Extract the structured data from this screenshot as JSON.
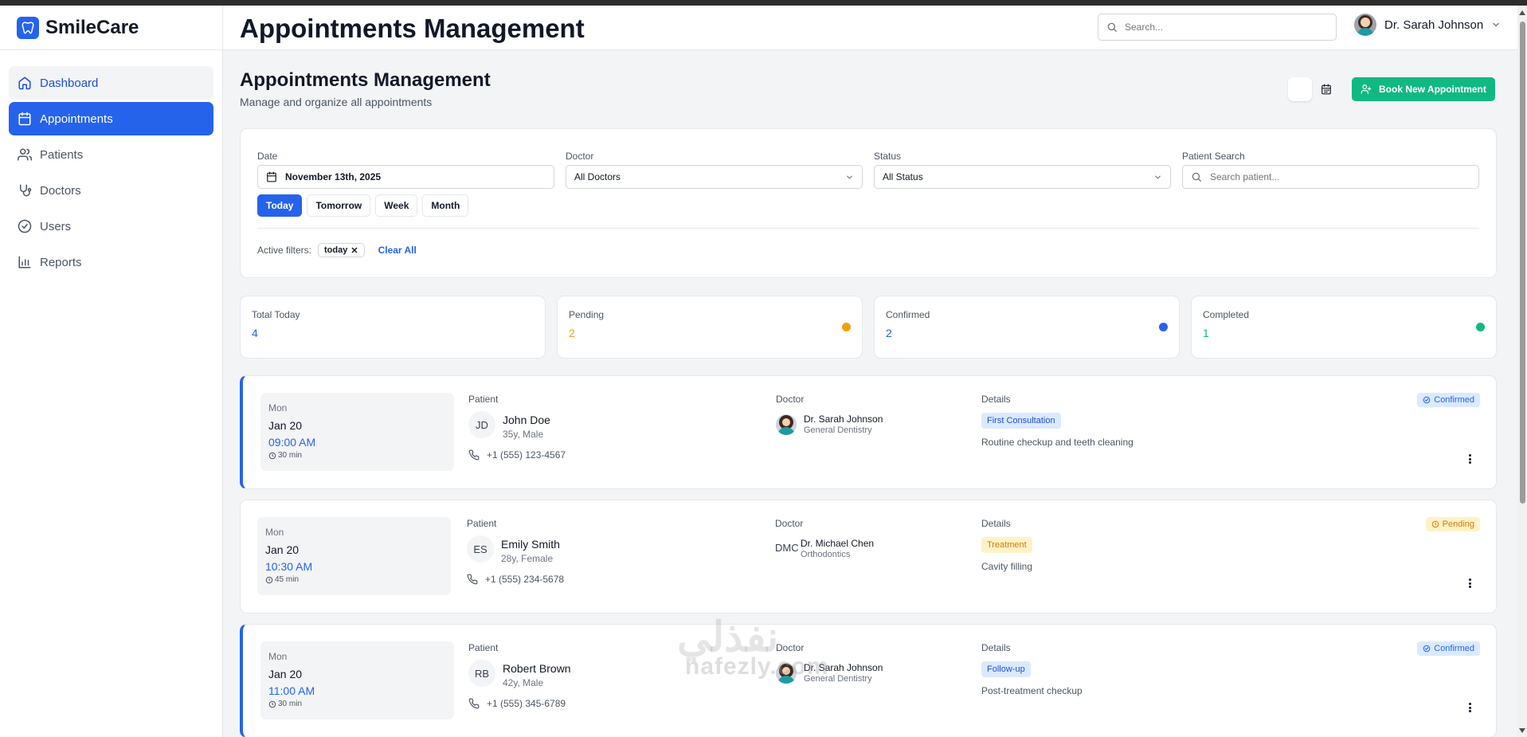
{
  "app": {
    "name": "SmileCare"
  },
  "sidebar": {
    "items": [
      {
        "label": "Dashboard"
      },
      {
        "label": "Appointments"
      },
      {
        "label": "Patients"
      },
      {
        "label": "Doctors"
      },
      {
        "label": "Users"
      },
      {
        "label": "Reports"
      }
    ],
    "active_index": 1,
    "hover_index": 0
  },
  "header": {
    "title": "Appointments Management",
    "search_placeholder": "Search...",
    "user_name": "Dr. Sarah Johnson"
  },
  "page": {
    "title": "Appointments Management",
    "subtitle": "Manage and organize all appointments",
    "book_button": "Book New Appointment"
  },
  "filters": {
    "date_label": "Date",
    "date_value": "November 13th, 2025",
    "doctor_label": "Doctor",
    "doctor_value": "All Doctors",
    "status_label": "Status",
    "status_value": "All Status",
    "search_label": "Patient Search",
    "search_placeholder": "Search patient...",
    "quick": [
      "Today",
      "Tomorrow",
      "Week",
      "Month"
    ],
    "quick_selected": "Today",
    "active_label": "Active filters:",
    "active_chip": "today",
    "clear_label": "Clear All"
  },
  "stats": [
    {
      "label": "Total Today",
      "value": "4",
      "color": "#2563eb"
    },
    {
      "label": "Pending",
      "value": "2",
      "color": "#f59e0b"
    },
    {
      "label": "Confirmed",
      "value": "2",
      "color": "#2563eb"
    },
    {
      "label": "Completed",
      "value": "1",
      "color": "#10b981"
    }
  ],
  "columns": {
    "patient": "Patient",
    "doctor": "Doctor",
    "details": "Details"
  },
  "appointments": [
    {
      "day": "Mon",
      "date": "Jan 20",
      "time": "09:00 AM",
      "duration": "30 min",
      "initials": "JD",
      "patient": "John Doe",
      "meta": "35y, Male",
      "phone": "+1 (555) 123-4567",
      "doctor": "Dr. Sarah Johnson",
      "specialty": "General Dentistry",
      "doctor_initials": "",
      "type": "First Consultation",
      "notes": "Routine checkup and teeth cleaning",
      "status": "Confirmed"
    },
    {
      "day": "Mon",
      "date": "Jan 20",
      "time": "10:30 AM",
      "duration": "45 min",
      "initials": "ES",
      "patient": "Emily Smith",
      "meta": "28y, Female",
      "phone": "+1 (555) 234-5678",
      "doctor": "Dr. Michael Chen",
      "specialty": "Orthodontics",
      "doctor_initials": "DMC",
      "type": "Treatment",
      "notes": "Cavity filling",
      "status": "Pending"
    },
    {
      "day": "Mon",
      "date": "Jan 20",
      "time": "11:00 AM",
      "duration": "30 min",
      "initials": "RB",
      "patient": "Robert Brown",
      "meta": "42y, Male",
      "phone": "+1 (555) 345-6789",
      "doctor": "Dr. Sarah Johnson",
      "specialty": "General Dentistry",
      "doctor_initials": "",
      "type": "Follow-up",
      "notes": "Post-treatment checkup",
      "status": "Confirmed"
    }
  ],
  "watermark": {
    "arabic": "نفذلي",
    "latin": "nafezly.com"
  }
}
